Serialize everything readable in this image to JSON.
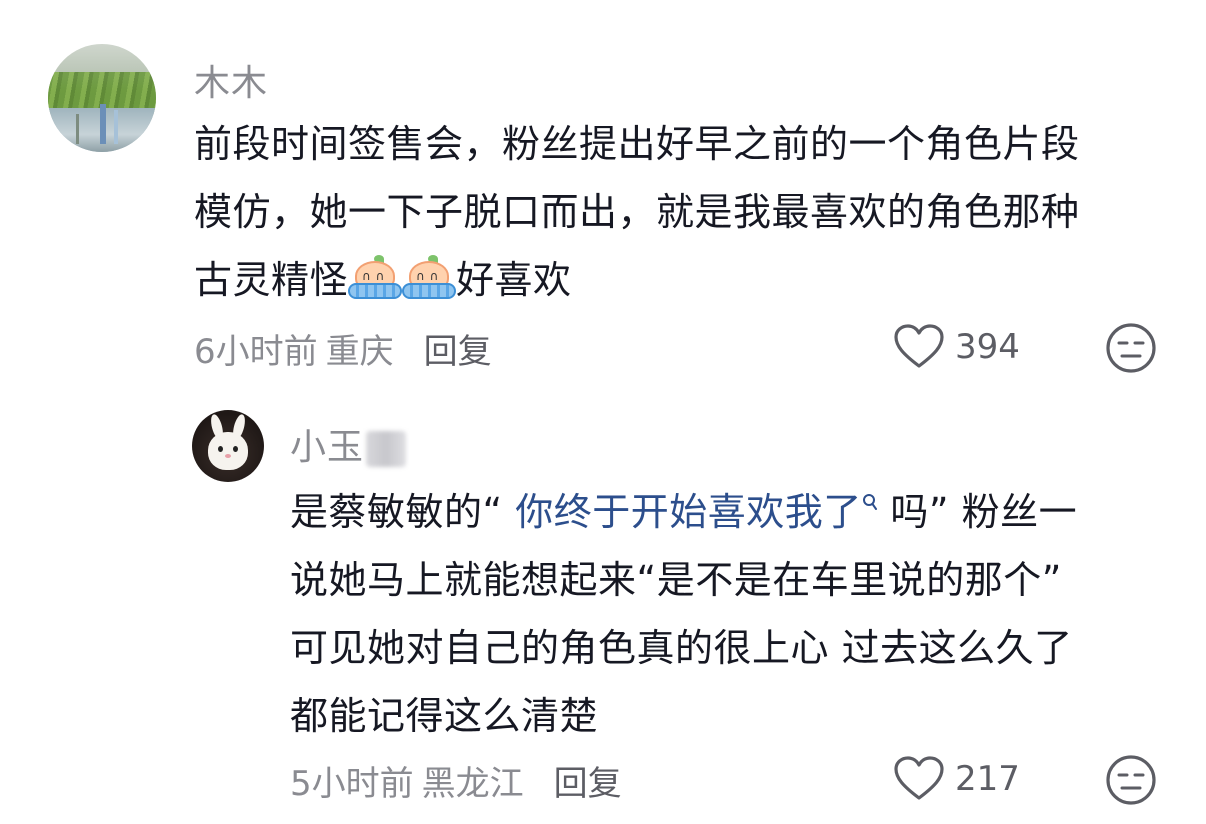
{
  "comments": [
    {
      "username": "木木",
      "lines": [
        "前段时间签售会，粉丝提出好早之前的一个角色片段",
        "模仿，她一下子脱口而出，就是我最喜欢的角色那种"
      ],
      "line3_before": "古灵精怪",
      "line3_after": "好喜欢",
      "emoji_name": "crying-emoji",
      "time": "6小时前",
      "location": "重庆",
      "reply_label": "回复",
      "likes": "394"
    },
    {
      "username": "小玉",
      "line1_before": "是蔡敏敏的“ ",
      "line1_link": "你终于开始喜欢我了",
      "line1_after": " 吗” 粉丝一",
      "lines": [
        "说她马上就能想起来“是不是在车里说的那个”",
        "可见她对自己的角色真的很上心 过去这么久了",
        "都能记得这么清楚"
      ],
      "time": "5小时前",
      "location": "黑龙江",
      "reply_label": "回复",
      "likes": "217"
    }
  ],
  "colors": {
    "text": "#161823",
    "muted": "#8a8b91",
    "link": "#2c4e8c"
  }
}
